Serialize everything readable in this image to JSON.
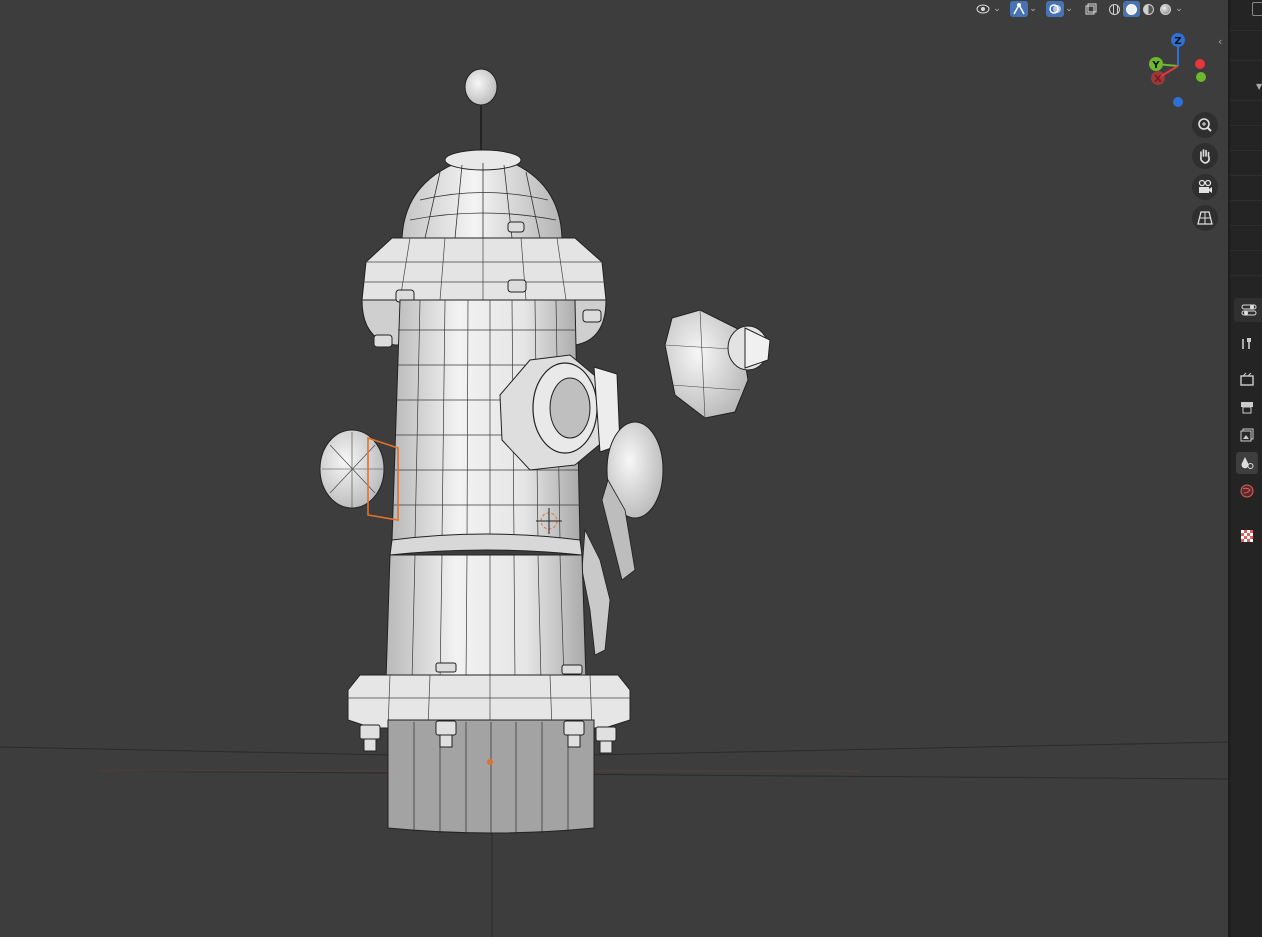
{
  "viewport": {
    "header": {
      "buttons": [
        {
          "name": "visibility-icon",
          "active": false
        },
        {
          "name": "gizmo-toggle-icon",
          "active": true
        },
        {
          "name": "overlays-icon",
          "active": true
        },
        {
          "name": "xray-toggle-icon",
          "active": false
        }
      ],
      "shading_modes": [
        "wireframe",
        "solid",
        "material-preview",
        "rendered"
      ],
      "shading_selected": "solid"
    },
    "gizmo": {
      "axes": [
        {
          "label": "Z",
          "color": "#2f6fd6"
        },
        {
          "label": "Y",
          "color": "#6db82f"
        },
        {
          "label": "X",
          "color": "#e5363d"
        }
      ],
      "nav_buttons": [
        "zoom-icon",
        "pan-hand-icon",
        "camera-view-icon",
        "perspective-grid-icon"
      ]
    },
    "colors": {
      "background": "#3d3d3d",
      "accent": "#4772b3",
      "selection": "#e2712b"
    }
  },
  "properties_tabs": [
    {
      "name": "tool-tab-icon",
      "selected": false
    },
    {
      "name": "render-tab-icon",
      "selected": false
    },
    {
      "name": "output-tab-icon",
      "selected": false
    },
    {
      "name": "view-layer-tab-icon",
      "selected": false
    },
    {
      "name": "scene-tab-icon",
      "selected": true
    },
    {
      "name": "world-tab-icon",
      "selected": false
    },
    {
      "name": "texture-tab-icon",
      "selected": false
    }
  ]
}
